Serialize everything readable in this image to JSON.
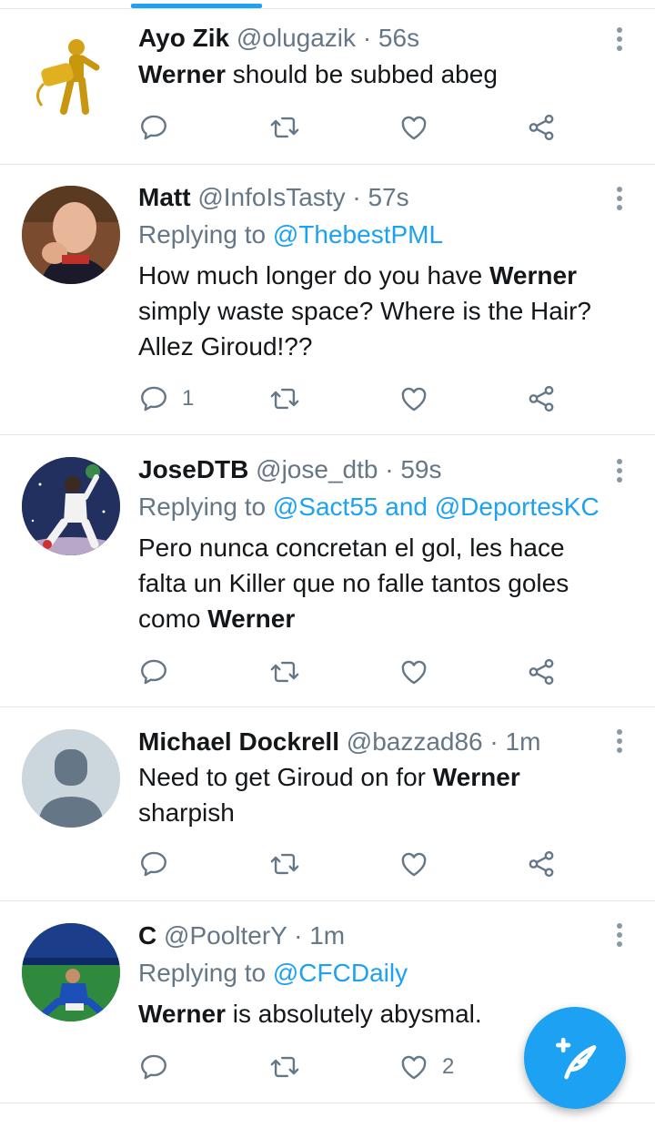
{
  "colors": {
    "accent": "#1da1f2",
    "muted": "#657786",
    "divider": "#e1e8ed"
  },
  "tweets": [
    {
      "name": "Ayo Zik",
      "handle": "@olugazik",
      "sep": "·",
      "time": "56s",
      "reply_prefix": "",
      "reply_targets": "",
      "body_parts": [
        {
          "b": "Werner"
        },
        {
          "t": " should be subbed abeg"
        }
      ],
      "counts": {
        "reply": "",
        "retweet": "",
        "like": ""
      }
    },
    {
      "name": "Matt",
      "handle": "@InfoIsTasty",
      "sep": "·",
      "time": "57s",
      "reply_prefix": "Replying to",
      "reply_targets": "@ThebestPML",
      "body_parts": [
        {
          "t": "How much longer do you have "
        },
        {
          "b": "Werner"
        },
        {
          "t": " simply waste space? Where is the Hair? Allez Giroud!??"
        }
      ],
      "counts": {
        "reply": "1",
        "retweet": "",
        "like": ""
      }
    },
    {
      "name": "JoseDTB",
      "handle": "@jose_dtb",
      "sep": "·",
      "time": "59s",
      "reply_prefix": "Replying to",
      "reply_targets": "@Sact55 and @DeportesKC",
      "body_parts": [
        {
          "t": "Pero nunca concretan el gol, les hace falta un Killer que no falle tantos goles como "
        },
        {
          "b": "Werner"
        }
      ],
      "counts": {
        "reply": "",
        "retweet": "",
        "like": ""
      }
    },
    {
      "name": "Michael Dockrell",
      "handle": "@bazzad86",
      "sep": "·",
      "time": "1m",
      "reply_prefix": "",
      "reply_targets": "",
      "body_parts": [
        {
          "t": "Need to get Giroud on for "
        },
        {
          "b": "Werner"
        },
        {
          "t": " sharpish"
        }
      ],
      "counts": {
        "reply": "",
        "retweet": "",
        "like": ""
      }
    },
    {
      "name": "C",
      "handle": "@PoolterY",
      "sep": "·",
      "time": "1m",
      "reply_prefix": "Replying to",
      "reply_targets": "@CFCDaily",
      "body_parts": [
        {
          "b": "Werner"
        },
        {
          "t": " is absolutely abysmal."
        }
      ],
      "counts": {
        "reply": "",
        "retweet": "",
        "like": "2"
      }
    }
  ],
  "icons": {
    "reply": "reply-icon",
    "retweet": "retweet-icon",
    "like": "heart-icon",
    "share": "share-icon",
    "more": "more-vertical-icon",
    "compose": "compose-tweet-icon"
  }
}
